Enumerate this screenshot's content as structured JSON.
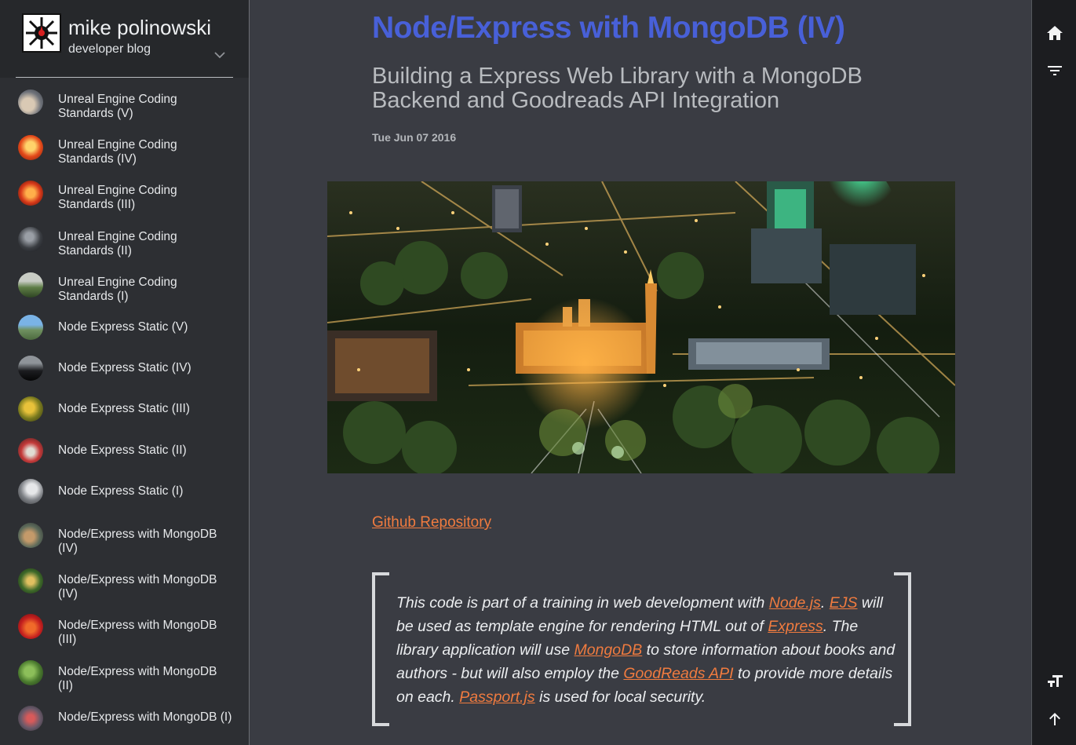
{
  "brand": {
    "title": "mike polinowski",
    "subtitle": "developer blog"
  },
  "sidebar": {
    "items": [
      {
        "label": "Unreal Engine Coding Standards (V)"
      },
      {
        "label": "Unreal Engine Coding Standards (IV)"
      },
      {
        "label": "Unreal Engine Coding Standards (III)"
      },
      {
        "label": "Unreal Engine Coding Standards (II)"
      },
      {
        "label": "Unreal Engine Coding Standards (I)"
      },
      {
        "label": "Node Express Static (V)"
      },
      {
        "label": "Node Express Static (IV)"
      },
      {
        "label": "Node Express Static (III)"
      },
      {
        "label": "Node Express Static (II)"
      },
      {
        "label": "Node Express Static (I)"
      },
      {
        "label": "Node/Express with MongoDB (IV)"
      },
      {
        "label": "Node/Express with MongoDB (IV)"
      },
      {
        "label": "Node/Express with MongoDB (III)"
      },
      {
        "label": "Node/Express with MongoDB (II)"
      },
      {
        "label": "Node/Express with MongoDB (I)"
      }
    ]
  },
  "post": {
    "title": "Node/Express with MongoDB (IV)",
    "subtitle": "Building a Express Web Library with a MongoDB Backend and Goodreads API Integration",
    "date": "Tue Jun 07 2016",
    "repo_link": "Github Repository",
    "quote": {
      "t1": "This code is part of a training in web development with ",
      "l1": "Node.js",
      "t2": ". ",
      "l2": "EJS",
      "t3": " will be used as template engine for rendering HTML out of ",
      "l3": "Express",
      "t4": ". The library application will use ",
      "l4": "MongoDB",
      "t5": " to store information about books and authors - but will also employ the ",
      "l5": "GoodReads API",
      "t6": " to provide more details on each. ",
      "l6": "Passport.js",
      "t7": " is used for local security."
    }
  },
  "rail": {
    "icons": [
      "home-icon",
      "filter-icon",
      "text-size-icon",
      "arrow-up-icon"
    ]
  },
  "colors": {
    "accent_title": "#4860d8",
    "link": "#f07b3f",
    "background": "#3a3c43",
    "sidebar": "#2d2f33"
  }
}
